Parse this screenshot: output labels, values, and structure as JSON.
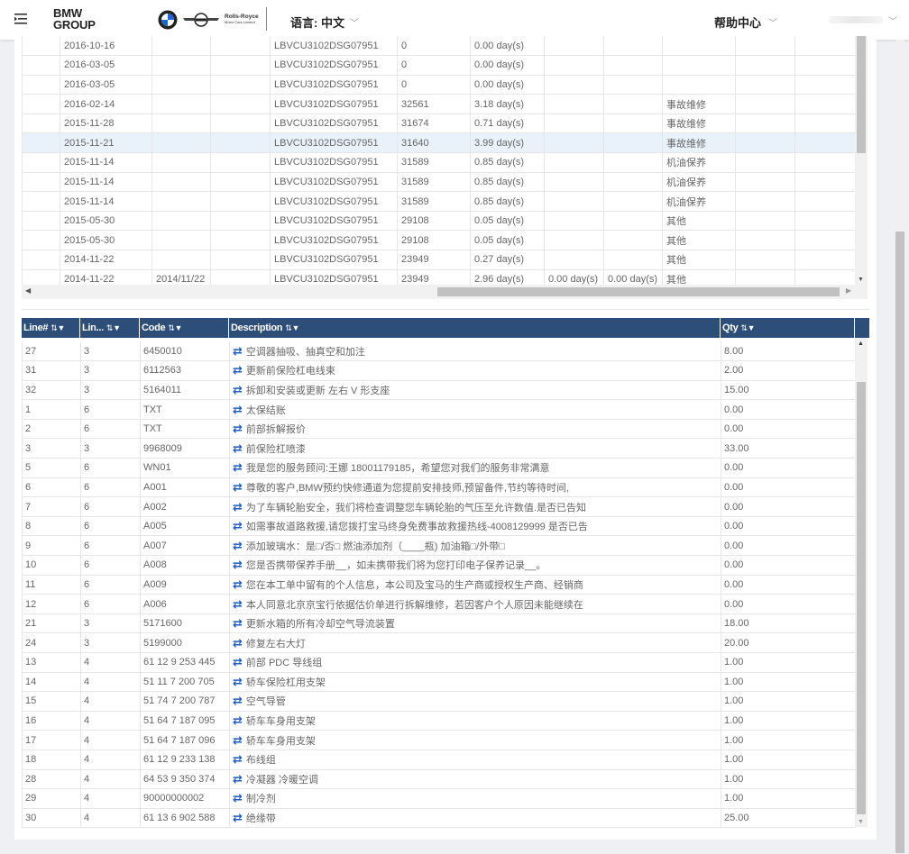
{
  "header": {
    "brand_line1": "BMW",
    "brand_line2": "GROUP",
    "rr_line1": "Rolls-Royce",
    "rr_line2": "Motor Cars Limited",
    "language_label": "语言: 中文",
    "help_label": "帮助中心"
  },
  "upper_table": {
    "rows": [
      [
        "",
        "2016-10-16",
        "",
        "",
        "LBVCU3102DSG07951",
        "0",
        "0.00 day(s)",
        "",
        "",
        "",
        "",
        ""
      ],
      [
        "",
        "2016-03-05",
        "",
        "",
        "LBVCU3102DSG07951",
        "0",
        "0.00 day(s)",
        "",
        "",
        "",
        "",
        ""
      ],
      [
        "",
        "2016-03-05",
        "",
        "",
        "LBVCU3102DSG07951",
        "0",
        "0.00 day(s)",
        "",
        "",
        "",
        "",
        ""
      ],
      [
        "",
        "2016-02-14",
        "",
        "",
        "LBVCU3102DSG07951",
        "32561",
        "3.18 day(s)",
        "",
        "",
        "事故维修",
        "",
        ""
      ],
      [
        "",
        "2015-11-28",
        "",
        "",
        "LBVCU3102DSG07951",
        "31674",
        "0.71 day(s)",
        "",
        "",
        "事故维修",
        "",
        ""
      ],
      [
        "",
        "2015-11-21",
        "",
        "",
        "LBVCU3102DSG07951",
        "31640",
        "3.99 day(s)",
        "",
        "",
        "事故维修",
        "",
        ""
      ],
      [
        "",
        "2015-11-14",
        "",
        "",
        "LBVCU3102DSG07951",
        "31589",
        "0.85 day(s)",
        "",
        "",
        "机油保养",
        "",
        ""
      ],
      [
        "",
        "2015-11-14",
        "",
        "",
        "LBVCU3102DSG07951",
        "31589",
        "0.85 day(s)",
        "",
        "",
        "机油保养",
        "",
        ""
      ],
      [
        "",
        "2015-11-14",
        "",
        "",
        "LBVCU3102DSG07951",
        "31589",
        "0.85 day(s)",
        "",
        "",
        "机油保养",
        "",
        ""
      ],
      [
        "",
        "2015-05-30",
        "",
        "",
        "LBVCU3102DSG07951",
        "29108",
        "0.05 day(s)",
        "",
        "",
        "其他",
        "",
        ""
      ],
      [
        "",
        "2015-05-30",
        "",
        "",
        "LBVCU3102DSG07951",
        "29108",
        "0.05 day(s)",
        "",
        "",
        "其他",
        "",
        ""
      ],
      [
        "",
        "2014-11-22",
        "",
        "",
        "LBVCU3102DSG07951",
        "23949",
        "0.27 day(s)",
        "",
        "",
        "其他",
        "",
        ""
      ],
      [
        "",
        "2014-11-22",
        "2014/11/22",
        "",
        "LBVCU3102DSG07951",
        "23949",
        "2.96 day(s)",
        "0.00 day(s)",
        "0.00 day(s)",
        "其他",
        "",
        ""
      ]
    ]
  },
  "lower_table": {
    "headers": [
      "Line#",
      "Lin...",
      "Code",
      "Description",
      "Qty"
    ],
    "rows": [
      [
        "27",
        "3",
        "6450010",
        "空调器抽吸、抽真空和加注",
        "8.00"
      ],
      [
        "31",
        "3",
        "6112563",
        "更新前保险杠电线束",
        "2.00"
      ],
      [
        "32",
        "3",
        "5164011",
        "拆卸和安装或更新 左右 V 形支座",
        "15.00"
      ],
      [
        "1",
        "6",
        "TXT",
        "太保结账",
        "0.00"
      ],
      [
        "2",
        "6",
        "TXT",
        "前部拆解报价",
        "0.00"
      ],
      [
        "3",
        "3",
        "9968009",
        "前保险杠喷漆",
        "33.00"
      ],
      [
        "5",
        "6",
        "WN01",
        "我是您的服务顾问:王娜 18001179185，希望您对我们的服务非常满意",
        "0.00"
      ],
      [
        "6",
        "6",
        "A001",
        "尊敬的客户,BMW预约快修通道为您提前安排技师,预留备件,节约等待时间,",
        "0.00"
      ],
      [
        "7",
        "6",
        "A002",
        "为了车辆轮胎安全，我们将检查调整您车辆轮胎的气压至允许数值.是否已告知",
        "0.00"
      ],
      [
        "8",
        "6",
        "A005",
        "如需事故道路救援,请您拨打宝马终身免费事故救援热线-4008129999 是否已告",
        "0.00"
      ],
      [
        "9",
        "6",
        "A007",
        "添加玻璃水：是□/否□ 燃油添加剂（____瓶) 加油箱□/外带□",
        "0.00"
      ],
      [
        "10",
        "6",
        "A008",
        "您是否携带保养手册__，如未携带我们将为您打印电子保养记录__。",
        "0.00"
      ],
      [
        "11",
        "6",
        "A009",
        "您在本工单中留有的个人信息，本公司及宝马的生产商或授权生产商、经销商",
        "0.00"
      ],
      [
        "12",
        "6",
        "A006",
        "本人同意北京京宝行依据估价单进行拆解维修，若因客户个人原因未能继续在",
        "0.00"
      ],
      [
        "21",
        "3",
        "5171600",
        "更新水箱的所有冷却空气导流装置",
        "18.00"
      ],
      [
        "24",
        "3",
        "5199000",
        "修复左右大灯",
        "20.00"
      ],
      [
        "13",
        "4",
        "61 12 9 253 445",
        "前部 PDC 导线组",
        "1.00"
      ],
      [
        "14",
        "4",
        "51 11 7 200 705",
        "轿车保险杠用支架",
        "1.00"
      ],
      [
        "15",
        "4",
        "51 74 7 200 787",
        "空气导管",
        "1.00"
      ],
      [
        "16",
        "4",
        "51 64 7 187 095",
        "轿车车身用支架",
        "1.00"
      ],
      [
        "17",
        "4",
        "51 64 7 187 096",
        "轿车车身用支架",
        "1.00"
      ],
      [
        "18",
        "4",
        "61 12 9 233 138",
        "布线组",
        "1.00"
      ],
      [
        "28",
        "4",
        "64 53 9 350 374",
        "冷凝器 冷暖空调",
        "1.00"
      ],
      [
        "29",
        "4",
        "90000000002",
        "制冷剂",
        "1.00"
      ],
      [
        "30",
        "4",
        "61 13 6 902 588",
        "绝缘带",
        "25.00"
      ]
    ]
  },
  "colors": {
    "header_bar": "#2d4e78",
    "selected_row": "#e9f1fb",
    "desc_icon": "#1e5bc6"
  },
  "icons": {
    "menu": "menu-icon",
    "sort": "sort-filter-icon",
    "desc": "swap-arrows-icon"
  }
}
